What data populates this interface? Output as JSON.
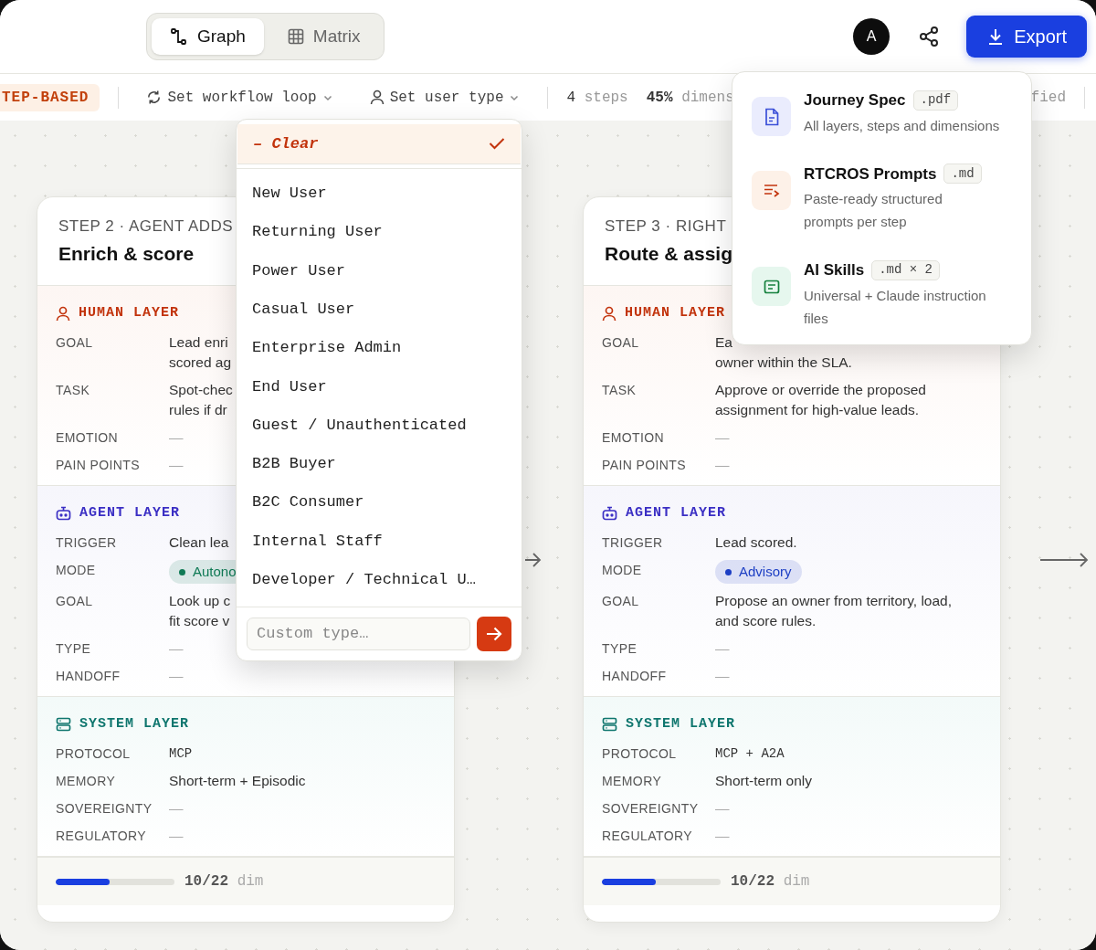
{
  "view_toggle": [
    {
      "label": "Graph",
      "kind": "graph",
      "selected": true
    },
    {
      "label": "Matrix",
      "kind": "matrix",
      "selected": false
    }
  ],
  "header": {
    "avatar": "A",
    "export_label": "Export"
  },
  "toolbar": {
    "badge": "TEP-BASED",
    "workflow_loop": "Set workflow loop",
    "user_type": "Set user type",
    "steps_count": "4",
    "steps_label": "steps",
    "dims_count": "45%",
    "dims_label": "dimens",
    "right_fragment": "fied"
  },
  "cards": [
    {
      "step": "STEP 2 · AGENT ADDS",
      "title": "Enrich & score",
      "layers": [
        {
          "kind": "human",
          "label": "HUMAN LAYER",
          "rows": [
            {
              "label": "GOAL",
              "lines": [
                "Lead enri",
                "scored ag"
              ]
            },
            {
              "label": "TASK",
              "lines": [
                "Spot-chec",
                "rules if dr"
              ]
            },
            {
              "label": "EMOTION",
              "lines": [
                "—"
              ]
            },
            {
              "label": "PAIN POINTS",
              "lines": [
                "—"
              ]
            }
          ]
        },
        {
          "kind": "agent",
          "label": "AGENT LAYER",
          "rows": [
            {
              "label": "TRIGGER",
              "lines": [
                "Clean lea"
              ]
            },
            {
              "label": "MODE",
              "pill": {
                "text": "Autono",
                "color": "#0f7a55"
              }
            },
            {
              "label": "GOAL",
              "lines": [
                "Look up c",
                "fit score v"
              ]
            },
            {
              "label": "TYPE",
              "lines": [
                "—"
              ]
            },
            {
              "label": "HANDOFF",
              "lines": [
                "—"
              ]
            }
          ]
        },
        {
          "kind": "system",
          "label": "SYSTEM LAYER",
          "rows": [
            {
              "label": "PROTOCOL",
              "lines": [
                "MCP"
              ],
              "mono": true
            },
            {
              "label": "MEMORY",
              "lines": [
                "Short-term + Episodic"
              ],
              "mono": false
            },
            {
              "label": "SOVEREIGNTY",
              "lines": [
                "—"
              ],
              "mono": false
            },
            {
              "label": "REGULATORY",
              "lines": [
                "—"
              ],
              "mono": false
            }
          ]
        }
      ],
      "progress": {
        "level": 0.45,
        "count": "10/22",
        "unit": "dim"
      }
    },
    {
      "step": "STEP 3 · RIGHT",
      "title": "Route & assig",
      "layers": [
        {
          "kind": "human",
          "label": "HUMAN LAYER",
          "rows": [
            {
              "label": "GOAL",
              "lines": [
                "Ea",
                "owner within the SLA."
              ]
            },
            {
              "label": "TASK",
              "lines": [
                "Approve or override the proposed",
                "assignment for high-value leads."
              ]
            },
            {
              "label": "EMOTION",
              "lines": [
                "—"
              ]
            },
            {
              "label": "PAIN POINTS",
              "lines": [
                "—"
              ]
            }
          ]
        },
        {
          "kind": "agent",
          "label": "AGENT LAYER",
          "rows": [
            {
              "label": "TRIGGER",
              "lines": [
                "Lead scored."
              ]
            },
            {
              "label": "MODE",
              "pill": {
                "text": "Advisory",
                "color": "#1d3fc4"
              }
            },
            {
              "label": "GOAL",
              "lines": [
                "Propose an owner from territory, load,",
                "and score rules."
              ]
            },
            {
              "label": "TYPE",
              "lines": [
                "—"
              ]
            },
            {
              "label": "HANDOFF",
              "lines": [
                "—"
              ]
            }
          ]
        },
        {
          "kind": "system",
          "label": "SYSTEM LAYER",
          "rows": [
            {
              "label": "PROTOCOL",
              "lines": [
                "MCP + A2A"
              ],
              "mono": true
            },
            {
              "label": "MEMORY",
              "lines": [
                "Short-term only"
              ],
              "mono": false
            },
            {
              "label": "SOVEREIGNTY",
              "lines": [
                "—"
              ],
              "mono": false
            },
            {
              "label": "REGULATORY",
              "lines": [
                "—"
              ],
              "mono": false
            }
          ]
        }
      ],
      "progress": {
        "level": 0.45,
        "count": "10/22",
        "unit": "dim"
      }
    }
  ],
  "user_type_menu": {
    "clear": {
      "dash": "–",
      "label": "Clear",
      "selected": true
    },
    "options": [
      {
        "label": "New User",
        "selected": false
      },
      {
        "label": "Returning User",
        "selected": false
      },
      {
        "label": "Power User",
        "selected": false
      },
      {
        "label": "Casual User",
        "selected": false
      },
      {
        "label": "Enterprise Admin",
        "selected": false
      },
      {
        "label": "End User",
        "selected": false
      },
      {
        "label": "Guest / Unauthenticated",
        "selected": false
      },
      {
        "label": "B2B Buyer",
        "selected": false
      },
      {
        "label": "B2C Consumer",
        "selected": false
      },
      {
        "label": "Internal Staff",
        "selected": false
      },
      {
        "label": "Developer / Technical U…",
        "selected": false
      }
    ],
    "custom": {
      "placeholder": "Custom type…"
    }
  },
  "export_menu": [
    [
      {
        "kind": "pdf",
        "title": "Journey Spec",
        "tag": ".pdf",
        "description": [
          "All layers, steps and dimensions"
        ]
      },
      {
        "kind": "prompts",
        "title": "RTCROS Prompts",
        "tag": ".md",
        "description": [
          "Paste-ready structured",
          "prompts per step"
        ]
      }
    ],
    [
      {
        "kind": "skills",
        "title": "AI Skills",
        "tag": ".md × 2",
        "description": [
          "Universal + Claude instruction",
          "files"
        ]
      }
    ]
  ]
}
